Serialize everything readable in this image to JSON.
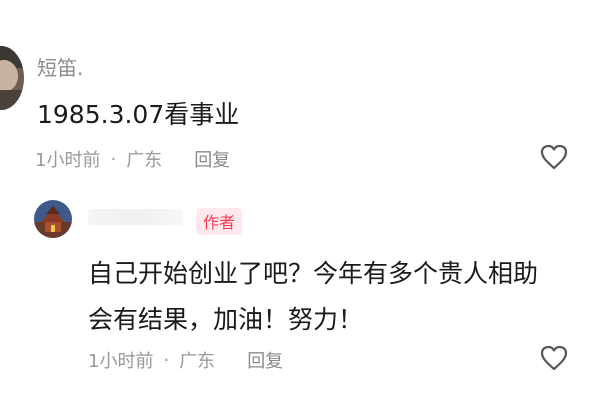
{
  "comment": {
    "username": "短笛.",
    "text": "1985.3.07看事业",
    "time": "1小时前",
    "separator": "·",
    "location": "广东",
    "reply_label": "回复",
    "like_icon": "heart-outline-icon"
  },
  "reply": {
    "badge": "作者",
    "lines": [
      "自己开始创业了吧？今年有多个贵人相助",
      "会有结果，加油！努力！"
    ],
    "time": "1小时前",
    "separator": "·",
    "location": "广东",
    "reply_label": "回复",
    "like_icon": "heart-outline-icon"
  },
  "colors": {
    "text_primary": "#1a1a1a",
    "text_secondary": "#999999",
    "author_badge_text": "#ff3b52",
    "author_badge_bg": "#ffe9ec"
  }
}
